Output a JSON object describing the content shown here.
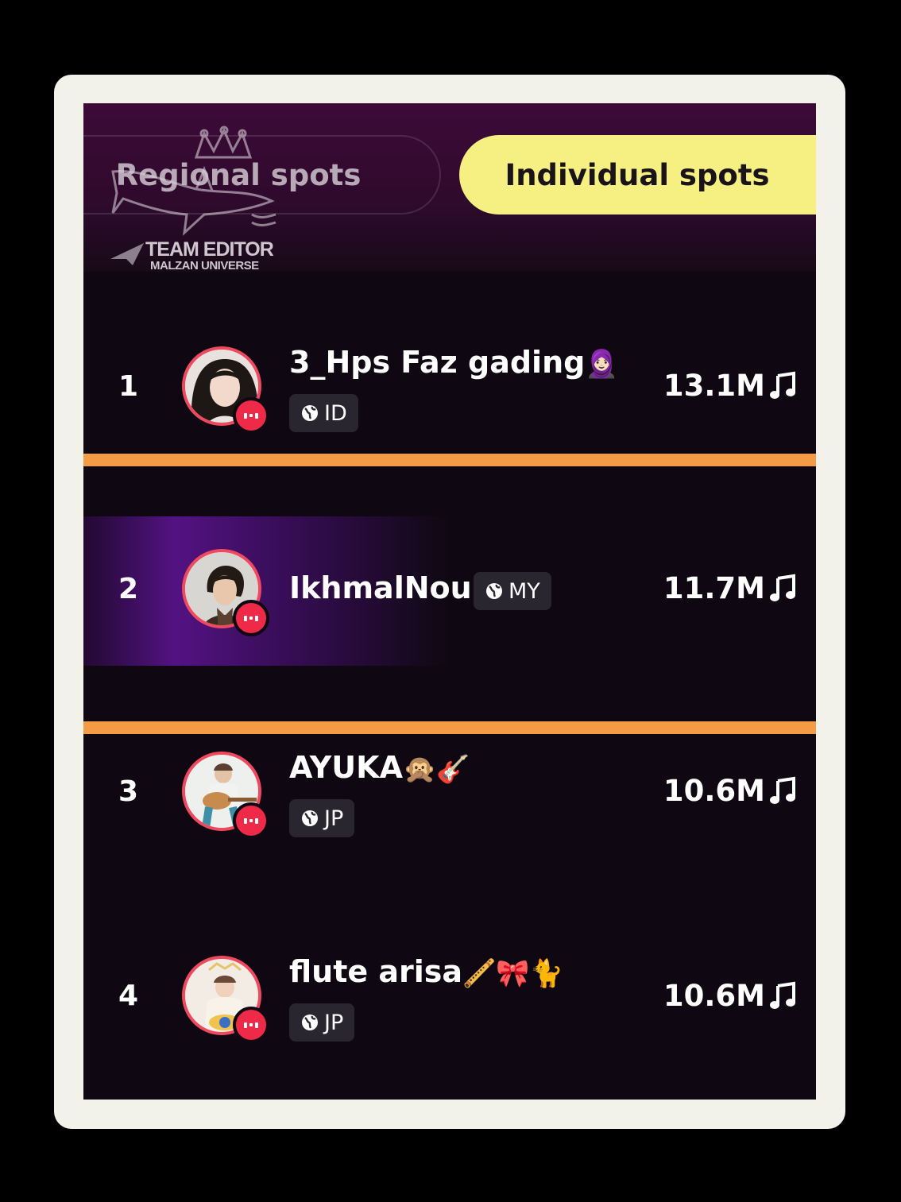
{
  "tabs": {
    "regional": "Regional spots",
    "individual": "Individual spots",
    "active": "individual"
  },
  "watermark": {
    "line1": "TEAM EDITOR",
    "line2": "MALZAN UNIVERSE"
  },
  "colors": {
    "active_tab": "#f6ef82",
    "divider": "#f59a45",
    "live_badge": "#ee2a48",
    "avatar_ring": "#f0485f"
  },
  "leaderboard": [
    {
      "rank": "1",
      "name": "3_Hps Faz gading",
      "name_emoji": "🧕🏻",
      "region": "ID",
      "score": "13.1M",
      "icon": "music-note-icon",
      "live": true
    },
    {
      "rank": "2",
      "name": "IkhmalNour",
      "name_emoji": "",
      "region": "MY",
      "score": "11.7M",
      "icon": "music-note-icon",
      "live": true
    },
    {
      "rank": "3",
      "name": "AYUKA",
      "name_emoji": "🙊🎸",
      "region": "JP",
      "score": "10.6M",
      "icon": "music-note-icon",
      "live": true
    },
    {
      "rank": "4",
      "name": "flute arisa",
      "name_emoji": "🪈🎀🐈",
      "region": "JP",
      "score": "10.6M",
      "icon": "music-note-icon",
      "live": true
    }
  ]
}
